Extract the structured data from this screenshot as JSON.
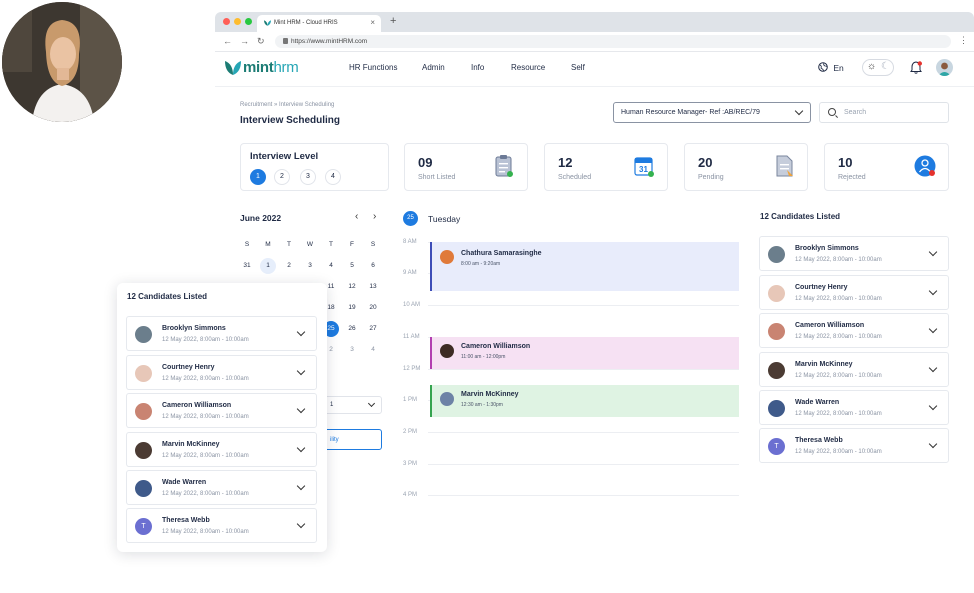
{
  "browser": {
    "tab_title": "Mint HRM - Cloud HRIS",
    "tab_close": "×",
    "new_tab": "+",
    "url": "https://www.mintHRM.com",
    "nav_icons": [
      "back-icon",
      "forward-icon",
      "reload-icon"
    ],
    "back": "←",
    "forward": "→",
    "reload": "↻",
    "menu": "⋮"
  },
  "header": {
    "logo_primary": "mint",
    "logo_secondary": "hrm",
    "nav": [
      "HR Functions",
      "Admin",
      "Info",
      "Resource",
      "Self"
    ],
    "language": "En",
    "sun": "☼",
    "moon": "☾"
  },
  "page": {
    "breadcrumb": "Recruitment » Interview Scheduling",
    "title": "Interview Scheduling",
    "position_select": "Human Resource Manager-  Ref :AB/REC/79",
    "search_placeholder": "Search"
  },
  "interview_level": {
    "title": "Interview Level",
    "levels": [
      "1",
      "2",
      "3",
      "4"
    ],
    "selected": "1"
  },
  "stats": [
    {
      "value": "09",
      "label": "Short Listed",
      "icon": "clipboard-icon"
    },
    {
      "value": "12",
      "label": "Scheduled",
      "icon": "calendar-icon"
    },
    {
      "value": "20",
      "label": "Pending",
      "icon": "document-pending-icon"
    },
    {
      "value": "10",
      "label": "Rejected",
      "icon": "user-rejected-icon"
    }
  ],
  "calendar": {
    "month": "June 2022",
    "prev": "‹",
    "next": "›",
    "weekdays": [
      "S",
      "M",
      "T",
      "W",
      "T",
      "F",
      "S"
    ],
    "row1": [
      "31",
      "1",
      "2",
      "3",
      "4",
      "5",
      "6"
    ],
    "row2_visible": [
      "11",
      "12",
      "13"
    ],
    "row3_visible": [
      "18",
      "19",
      "20"
    ],
    "row4_visible": [
      "25",
      "26",
      "27"
    ],
    "row5_visible": [
      "2",
      "3",
      "4"
    ],
    "today": "1",
    "selected": "25",
    "partial_select": "1",
    "partial_button": "ility"
  },
  "schedule": {
    "day_number": "25",
    "day_name": "Tuesday",
    "times": [
      "8 AM",
      "9 AM",
      "10 AM",
      "11 AM",
      "12 PM",
      "1 PM",
      "2 PM",
      "3 PM",
      "4 PM"
    ],
    "events": [
      {
        "name": "Chathura Samarasinghe",
        "time": "8:00 am - 9:20am",
        "color": "#e8ecfb",
        "border": "#3d4db7"
      },
      {
        "name": "Cameron Williamson",
        "time": "11:00 am - 12:00pm",
        "color": "#f6e1f3",
        "border": "#b23fb0"
      },
      {
        "name": "Marvin McKinney",
        "time": "12:30 am - 1:30pm",
        "color": "#dff3e3",
        "border": "#35a34f"
      }
    ]
  },
  "candidates": {
    "title": "12 Candidates Listed",
    "items": [
      {
        "name": "Brooklyn Simmons",
        "time": "12 May 2022, 8:00am - 10:00am",
        "initial": "",
        "color": "#6b7e8c"
      },
      {
        "name": "Courtney Henry",
        "time": "12 May 2022, 8:00am - 10:00am",
        "initial": "",
        "color": "#e7c7b8"
      },
      {
        "name": "Cameron Williamson",
        "time": "12 May 2022, 8:00am - 10:00am",
        "initial": "",
        "color": "#c98472"
      },
      {
        "name": "Marvin McKinney",
        "time": "12 May 2022, 8:00am - 10:00am",
        "initial": "",
        "color": "#4b3b33"
      },
      {
        "name": "Wade Warren",
        "time": "12 May 2022, 8:00am - 10:00am",
        "initial": "",
        "color": "#3f5a8a"
      },
      {
        "name": "Theresa Webb",
        "time": "12 May 2022, 8:00am - 10:00am",
        "initial": "T",
        "color": "#6b6fd1"
      }
    ]
  }
}
